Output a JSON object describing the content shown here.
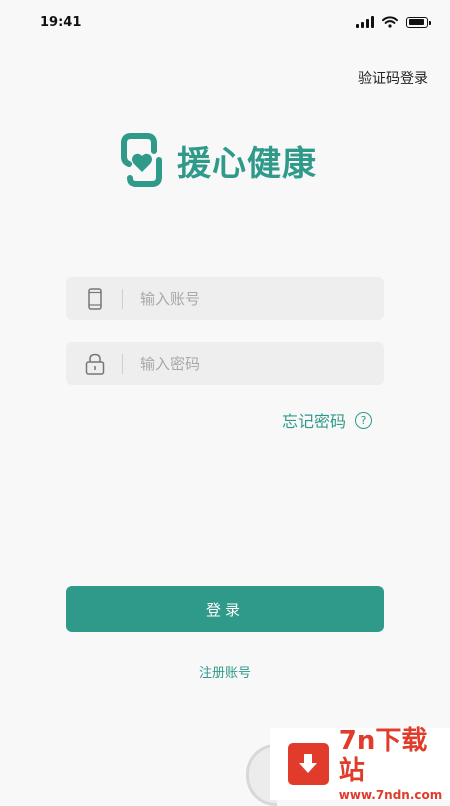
{
  "status_bar": {
    "time": "19:41"
  },
  "header": {
    "verify_login": "验证码登录"
  },
  "logo": {
    "name": "援心健康"
  },
  "form": {
    "account_placeholder": "输入账号",
    "password_placeholder": "输入密码",
    "forgot_password": "忘记密码",
    "help_symbol": "?",
    "login_label": "登录",
    "register_label": "注册账号"
  },
  "watermark": {
    "title": "7n下载站",
    "url": "www.7ndn.com"
  },
  "colors": {
    "accent": "#2f9a8a",
    "background": "#f8f8f8",
    "field_bg": "#eeeeee",
    "watermark_red": "#e03b2b"
  },
  "icons": [
    "cellular-signal-icon",
    "wifi-icon",
    "battery-icon",
    "logo-heart-icon",
    "phone-icon",
    "lock-icon",
    "help-icon",
    "download-arrow-icon"
  ]
}
